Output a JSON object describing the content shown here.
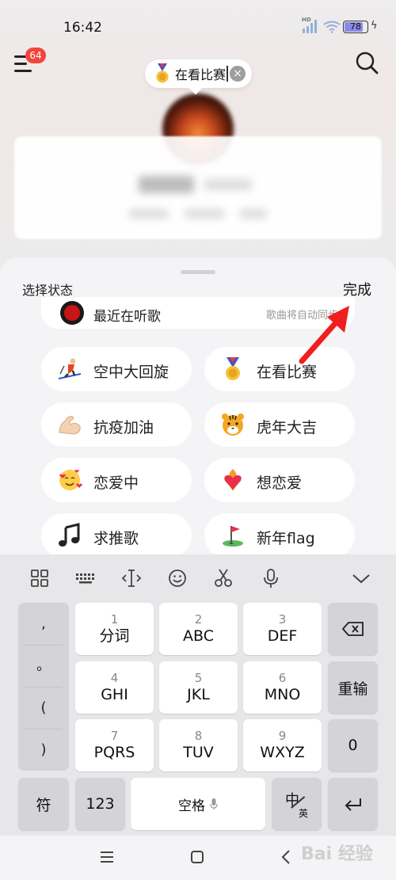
{
  "status_bar": {
    "time": "16:42",
    "battery": "78"
  },
  "header": {
    "notification_count": "64"
  },
  "status_pill": {
    "text": "在看比赛",
    "clear_glyph": "×"
  },
  "sheet": {
    "title": "选择状态",
    "done_label": "完成",
    "recent": {
      "label": "最近在听歌",
      "hint": "歌曲将自动同步"
    },
    "options": [
      {
        "label": "空中大回旋",
        "icon": "skier-icon"
      },
      {
        "label": "在看比赛",
        "icon": "medal-icon"
      },
      {
        "label": "抗疫加油",
        "icon": "flexed-biceps-icon"
      },
      {
        "label": "虎年大吉",
        "icon": "tiger-face-icon"
      },
      {
        "label": "恋爱中",
        "icon": "smiling-face-hearts-icon"
      },
      {
        "label": "想恋爱",
        "icon": "heart-on-fire-icon"
      },
      {
        "label": "求推歌",
        "icon": "musical-note-icon"
      },
      {
        "label": "新年flag",
        "icon": "golf-flag-icon"
      }
    ]
  },
  "keyboard": {
    "punctuation": [
      ",",
      "。",
      "(",
      ")"
    ],
    "keys": [
      {
        "num": "1",
        "label": "分词"
      },
      {
        "num": "2",
        "label": "ABC"
      },
      {
        "num": "3",
        "label": "DEF"
      },
      {
        "num": "4",
        "label": "GHI"
      },
      {
        "num": "5",
        "label": "JKL"
      },
      {
        "num": "6",
        "label": "MNO"
      },
      {
        "num": "7",
        "label": "PQRS"
      },
      {
        "num": "8",
        "label": "TUV"
      },
      {
        "num": "9",
        "label": "WXYZ"
      }
    ],
    "reenter_label": "重输",
    "zero_label": "0",
    "symbol_label": "符",
    "num_label": "123",
    "space_label": "空格",
    "lang_main": "中",
    "lang_sub": "英"
  },
  "watermark": "Bai 经验",
  "colors": {
    "badge": "#f2453d",
    "arrow": "#f01f1f",
    "keyboard_bg": "#e7e7ea"
  }
}
